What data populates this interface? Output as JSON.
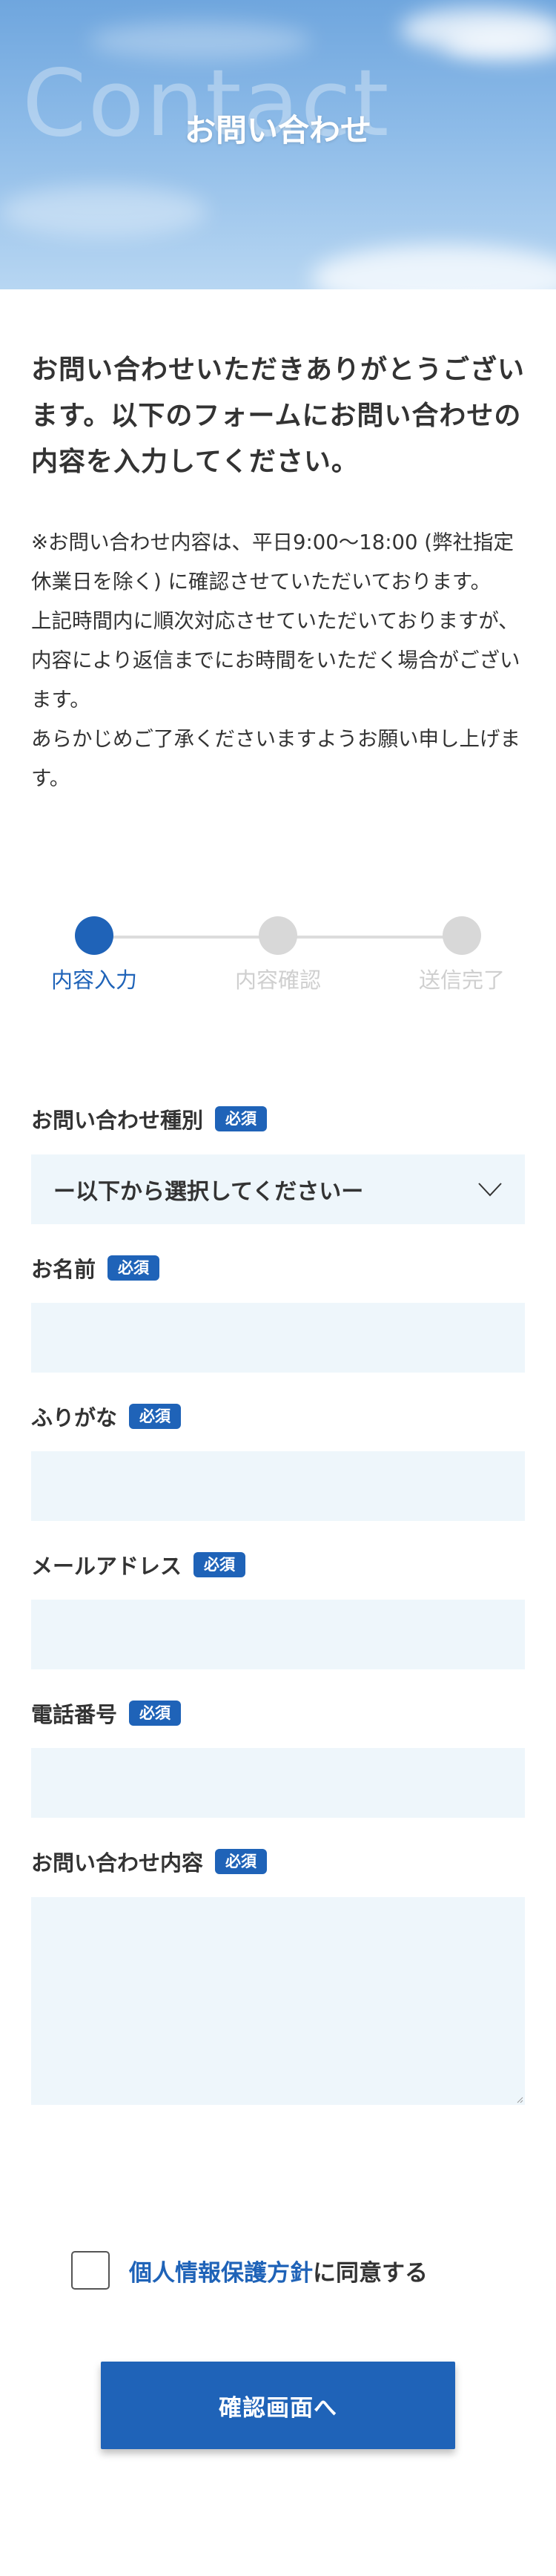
{
  "hero": {
    "background_text": "Contact",
    "title": "お問い合わせ"
  },
  "intro": {
    "lead": "お問い合わせいただきありがとうございます。以下のフォームにお問い合わせの内容を入力してください。",
    "notice_lines": [
      "※お問い合わせ内容は、平日9:00〜18:00 (弊社指定休業日を除く) に確認させていただいております。",
      "上記時間内に順次対応させていただいておりますが、内容により返信までにお時間をいただく場合がございます。",
      "あらかじめご了承くださいますようお願い申し上げます。"
    ]
  },
  "steps": [
    {
      "label": "内容入力",
      "active": true
    },
    {
      "label": "内容確認",
      "active": false
    },
    {
      "label": "送信完了",
      "active": false
    }
  ],
  "form": {
    "required_badge": "必須",
    "inquiry_type": {
      "label": "お問い合わせ種別",
      "selected": "ー以下から選択してくださいー"
    },
    "name": {
      "label": "お名前",
      "value": ""
    },
    "furigana": {
      "label": "ふりがな",
      "value": ""
    },
    "email": {
      "label": "メールアドレス",
      "value": ""
    },
    "phone": {
      "label": "電話番号",
      "value": ""
    },
    "message": {
      "label": "お問い合わせ内容",
      "value": ""
    }
  },
  "agreement": {
    "link_text": "個人情報保護方針",
    "suffix_text": "に同意する"
  },
  "submit_label": "確認画面へ",
  "colors": {
    "accent": "#1f63b8",
    "field_background": "#eef6fb",
    "inactive_step": "#d8d8d8"
  }
}
